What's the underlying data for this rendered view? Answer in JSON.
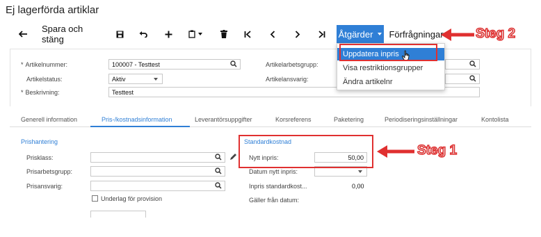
{
  "page": {
    "title": "Ej lagerförda artiklar"
  },
  "toolbar": {
    "back_icon": "arrow-left-icon",
    "save_close_label": "Spara och stäng",
    "actions_label": "Åtgärder",
    "inquiries_label": "Förfrågningar"
  },
  "actions_menu": {
    "items": [
      "Uppdatera inpris",
      "Visa restriktionsgrupper",
      "Ändra artikelnr"
    ]
  },
  "header_form": {
    "item_number_label": "Artikelnummer:",
    "item_number_value": "100007 - Testtest",
    "item_status_label": "Artikelstatus:",
    "item_status_value": "Aktiv",
    "description_label": "Beskrivning:",
    "description_value": "Testtest",
    "item_class_label": "Artikelarbetsgrupp:",
    "item_owner_label": "Artikelansvarig:",
    "required_marker": "*"
  },
  "tabs": [
    "Generell information",
    "Pris-/kostnadsinformation",
    "Leverantörsuppgifter",
    "Korsreferens",
    "Paketering",
    "Periodiseringsinställningar",
    "Kontolista"
  ],
  "price_section": {
    "title": "Prishantering",
    "price_class_label": "Prisklass:",
    "price_workgroup_label": "Prisarbetsgrupp:",
    "price_manager_label": "Prisansvarig:",
    "commission_label": "Underlag för provision"
  },
  "standard_cost": {
    "title": "Standardkostnad",
    "new_cost_label": "Nytt inpris:",
    "new_cost_value": "50,00",
    "new_cost_date_label": "Datum nytt inpris:",
    "std_cost_label": "Inpris standardkost...",
    "std_cost_value": "0,00",
    "effective_date_label": "Gäller från datum:"
  },
  "annotations": {
    "step1": "Steg 1",
    "step2": "Steg 2",
    "color": "#e03030"
  },
  "colors": {
    "accent": "#2f7fd6",
    "annotation_red": "#e03030"
  }
}
